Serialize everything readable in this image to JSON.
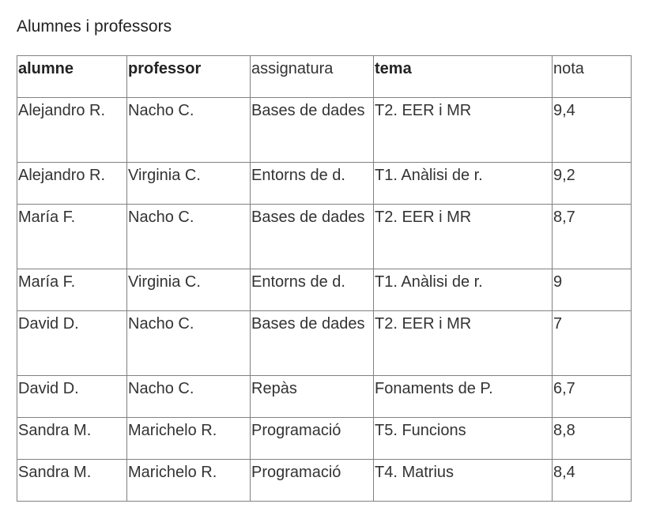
{
  "title": "Alumnes i professors",
  "headers": [
    "alumne",
    "professor",
    "assignatura",
    "tema",
    "nota"
  ],
  "rows": [
    [
      "Alejandro R.",
      "Nacho C.",
      "Bases de dades",
      "T2. EER i MR",
      "9,4"
    ],
    [
      "Alejandro R.",
      "Virginia C.",
      "Entorns de d.",
      "T1. Anàlisi de r.",
      "9,2"
    ],
    [
      "María F.",
      "Nacho C.",
      "Bases de dades",
      "T2. EER i MR",
      "8,7"
    ],
    [
      "María F.",
      "Virginia C.",
      "Entorns de d.",
      "T1. Anàlisi de r.",
      "9"
    ],
    [
      "David D.",
      "Nacho C.",
      "Bases de dades",
      "T2. EER i MR",
      "7"
    ],
    [
      "David D.",
      "Nacho C.",
      "Repàs",
      "Fonaments de P.",
      "6,7"
    ],
    [
      "Sandra M.",
      "Marichelo R.",
      "Programació",
      "T5. Funcions",
      "8,8"
    ],
    [
      "Sandra M.",
      "Marichelo R.",
      "Programació",
      "T4. Matrius",
      "8,4"
    ]
  ]
}
